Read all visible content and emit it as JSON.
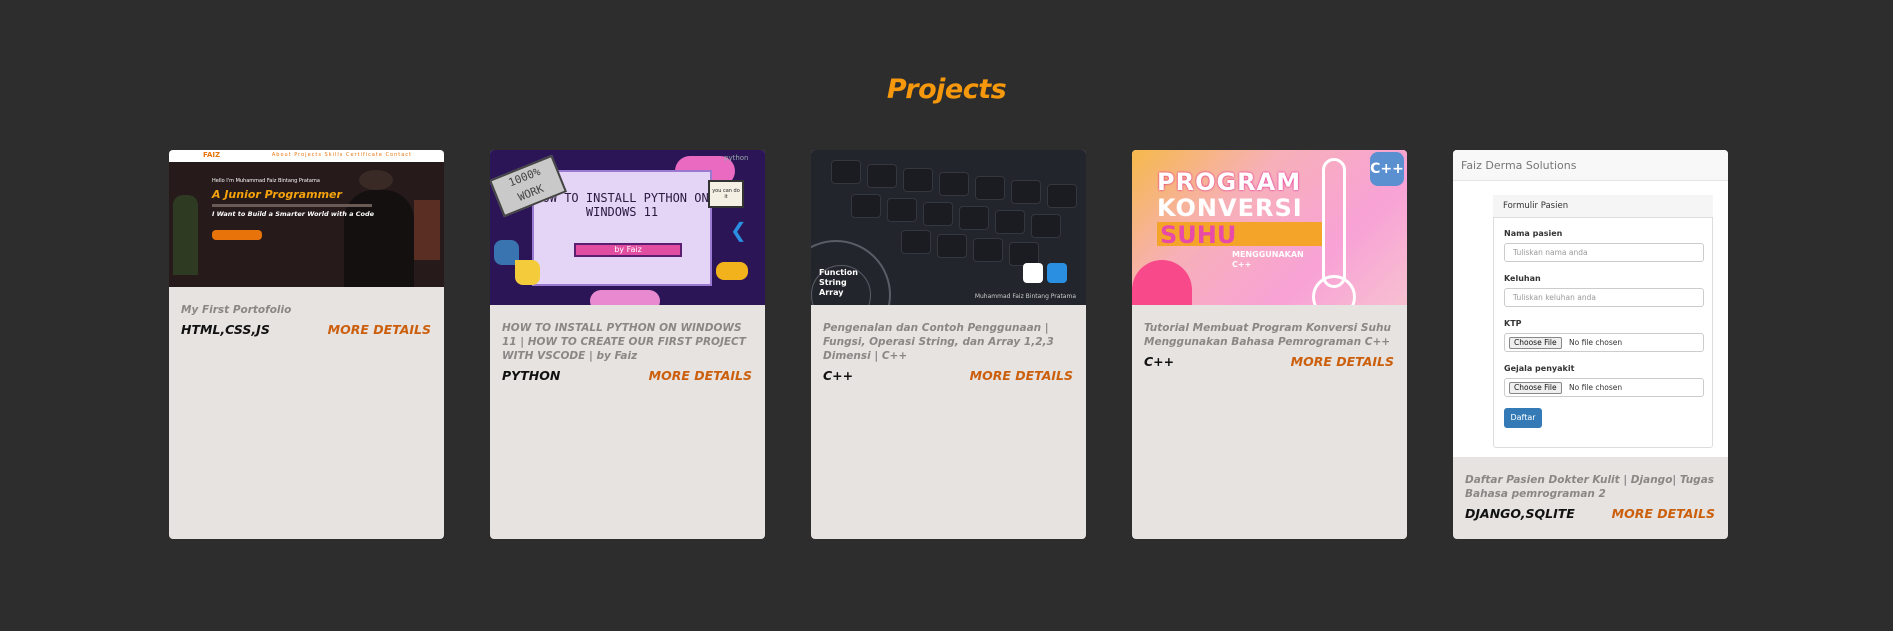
{
  "section": {
    "title": "Projects"
  },
  "projects": [
    {
      "description": "My First Portofolio",
      "tech": "HTML,CSS,JS",
      "more": "MORE DETAILS",
      "thumb": {
        "brand": "FAIZ",
        "nav": "About  Projects  Skills  Certificate  Contact",
        "hello": "Hello I'm Muhammad Faiz Bintang Pratama",
        "headline": "A Junior Programmer",
        "tagline": "I Want to Build a Smarter World with a Code"
      }
    },
    {
      "description": "HOW TO INSTALL PYTHON ON WINDOWS 11 | HOW TO CREATE OUR FIRST PROJECT WITH VSCODE | by Faiz",
      "tech": "PYTHON",
      "more": "MORE DETAILS",
      "thumb": {
        "headline": "HOW TO INSTALL PYTHON ON WINDOWS 11",
        "byline": "by Faiz",
        "sticker": "1000% WORK",
        "note": "you can do it",
        "logo": "python"
      }
    },
    {
      "description": "Pengenalan dan Contoh Penggunaan | Fungsi, Operasi String, dan Array 1,2,3 Dimensi | C++",
      "tech": "C++",
      "more": "MORE DETAILS",
      "thumb": {
        "label": "Function String Array",
        "author": "Muhammad Faiz Bintang Pratama"
      }
    },
    {
      "description": "Tutorial Membuat Program Konversi Suhu Menggunakan Bahasa Pemrograman C++",
      "tech": "C++",
      "more": "MORE DETAILS",
      "thumb": {
        "line1": "PROGRAM",
        "line2": "KONVERSI",
        "line3": "SUHU",
        "line4": "MENGGUNAKAN C++",
        "badge": "C++"
      }
    },
    {
      "description": "Daftar Pasien Dokter Kulit | Django| Tugas Bahasa pemrograman 2",
      "tech": "DJANGO,SQLITE",
      "more": "MORE DETAILS",
      "thumb": {
        "app_title": "Faiz Derma Solutions",
        "form_title": "Formulir Pasien",
        "label_name": "Nama pasien",
        "placeholder_name": "Tuliskan nama anda",
        "label_keluhan": "Keluhan",
        "placeholder_keluhan": "Tuliskan keluhan anda",
        "label_ktp": "KTP",
        "label_gejala": "Gejala penyakit",
        "choose_file": "Choose File",
        "no_file": "No file chosen",
        "submit": "Daftar"
      }
    }
  ],
  "colors": {
    "background": "#2e2d2d",
    "title": "#f5980c",
    "card": "#e6e3e1",
    "more_link": "#cc5f0c"
  }
}
